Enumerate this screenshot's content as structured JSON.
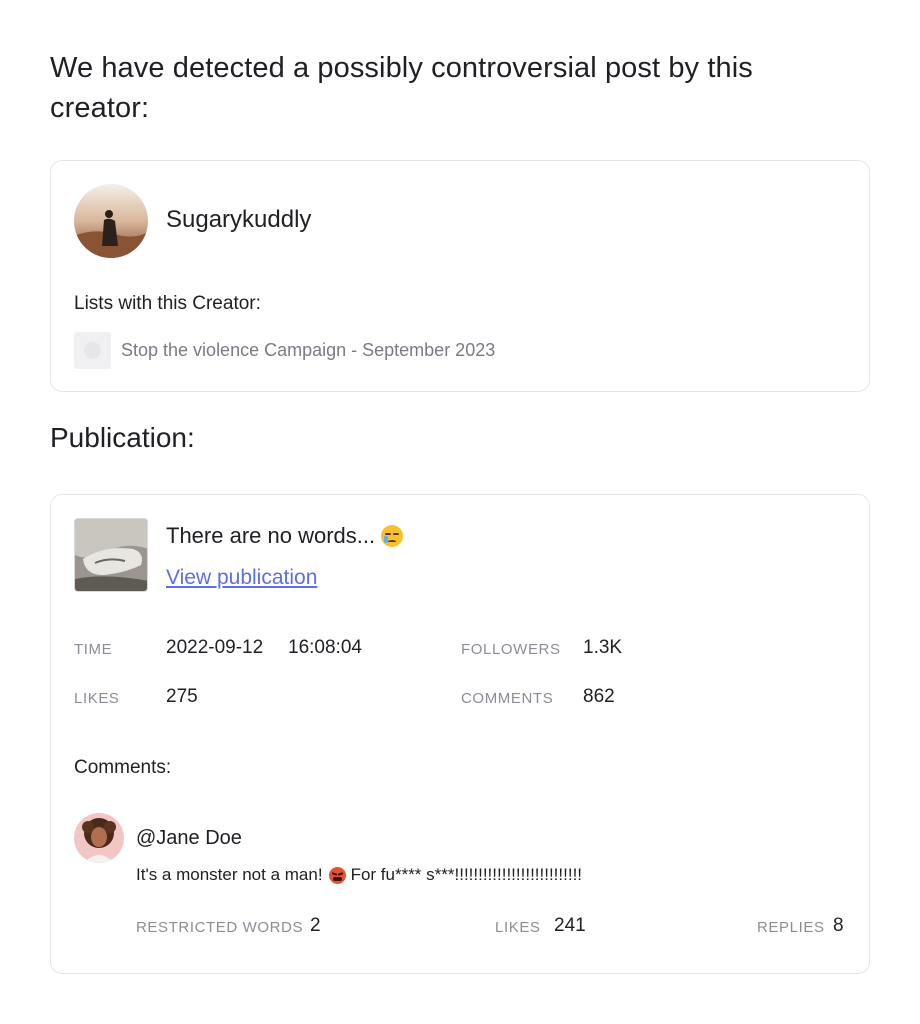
{
  "alert_heading": "We have detected a possibly controversial post by this creator:",
  "creator": {
    "name": "Sugarykuddly",
    "avatar_icon": "creator-avatar-photo",
    "lists_label": "Lists with this Creator:",
    "lists": [
      {
        "label": "Stop the violence Campaign - September 2023"
      }
    ]
  },
  "publication": {
    "section_title": "Publication:",
    "thumbnail_icon": "publication-thumbnail-photo",
    "text": "There are no words...",
    "emoji": "sad-tear-emoji",
    "link_label": "View publication",
    "stats": {
      "time_label": "TIME",
      "time_date": "2022-09-12",
      "time_clock": "16:08:04",
      "followers_label": "FOLLOWERS",
      "followers_value": "1.3K",
      "likes_label": "LIKES",
      "likes_value": "275",
      "comments_label": "COMMENTS",
      "comments_value": "862"
    },
    "comments_title": "Comments:",
    "comments": [
      {
        "user": "@Jane Doe",
        "text_before": "It's a monster not a man!",
        "emoji": "angry-face-emoji",
        "text_after": "For fu**** s***!!!!!!!!!!!!!!!!!!!!!!!!!!!",
        "restricted_label": "RESTRICTED WORDS",
        "restricted_value": "2",
        "likes_label": "LIKES",
        "likes_value": "241",
        "replies_label": "REPLIES",
        "replies_value": "8"
      }
    ]
  },
  "colors": {
    "link": "#5b6ef0",
    "muted_text": "#8c8c96",
    "card_border": "#e6e6ea"
  }
}
